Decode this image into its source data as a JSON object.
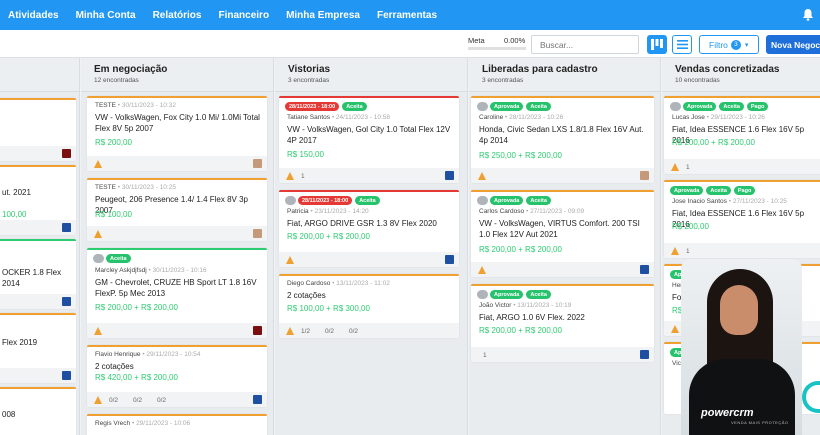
{
  "nav": {
    "items": [
      "Atividades",
      "Minha Conta",
      "Relatórios",
      "Financeiro",
      "Minha Empresa",
      "Ferramentas"
    ]
  },
  "toolbar": {
    "meta_label": "Meta",
    "meta_value": "0.00%",
    "meta_progress": 0,
    "search_placeholder": "Buscar...",
    "filter_label": "Filtro",
    "filter_count": "3",
    "new_button": "Nova Negociação"
  },
  "columns": [
    {
      "title": "",
      "count": "",
      "cards": [
        {
          "meta": "",
          "date": "",
          "vehicle": "",
          "price": ""
        },
        {
          "meta": "",
          "date": "",
          "vehicle": "ut. 2021",
          "price": "100,00"
        },
        {
          "meta": "",
          "date": "",
          "vehicle": "OCKER 1.8 Flex 2014",
          "price": ""
        },
        {
          "meta": "",
          "date": "",
          "vehicle": "Flex 2019",
          "price": ""
        },
        {
          "meta": "",
          "date": "",
          "vehicle": "008",
          "price": ""
        }
      ]
    },
    {
      "title": "Em negociação",
      "count": "12 encontradas",
      "cards": [
        {
          "meta": "TESTE",
          "date": "• 30/11/2023 - 10:32",
          "vehicle": "VW - VolksWagen, Fox City 1.0 Mi/ 1.0Mi Total Flex 8V 5p 2007",
          "price": "R$ 200,00"
        },
        {
          "meta": "TESTE",
          "date": "• 30/11/2023 - 10:25",
          "vehicle": "Peugeot, 206 Presence 1.4/ 1.4 Flex 8V 3p 2007",
          "price": "R$ 100,00"
        },
        {
          "meta": "Marcley Askjdjfsdj",
          "date": "• 30/11/2023 - 10:16",
          "vehicle": "GM - Chevrolet, CRUZE HB Sport LT 1.8 16V FlexP. 5p Mec 2013",
          "price": "R$ 200,00 + R$ 200,00",
          "badges": [
            "Aceita"
          ]
        },
        {
          "meta": "Flavio Henrique",
          "date": "• 29/11/2023 - 10:54",
          "vehicle": "2 cotações",
          "price": "R$ 420,00 + R$ 200,00",
          "stats": [
            "0/2",
            "0/2",
            "0/2"
          ]
        },
        {
          "meta": "Regis Vrech",
          "date": "• 29/11/2023 - 10:06",
          "vehicle": "",
          "price": ""
        }
      ]
    },
    {
      "title": "Vistorias",
      "count": "3 encontradas",
      "cards": [
        {
          "meta": "Tatiane Santos",
          "date": "• 24/11/2023 - 10:58",
          "vehicle": "VW - VolksWagen, Gol City 1.0 Total Flex 12V 4P 2017",
          "price": "R$ 150,00",
          "badges": [
            "28/11/2023 - 18:00",
            "Aceita"
          ],
          "stats": [
            "1"
          ]
        },
        {
          "meta": "Patricia",
          "date": "• 23/11/2023 - 14:20",
          "vehicle": "Fiat, ARGO DRIVE GSR 1.3 8V Flex 2020",
          "price": "R$ 200,00 + R$ 200,00",
          "badges": [
            "28/11/2023 - 18:00",
            "Aceita"
          ]
        },
        {
          "meta": "Diego Cardoso",
          "date": "• 13/11/2023 - 11:02",
          "vehicle": "2 cotações",
          "price": "R$ 100,00 + R$ 300,00",
          "stats": [
            "1/2",
            "0/2",
            "0/2"
          ]
        }
      ]
    },
    {
      "title": "Liberadas para cadastro",
      "count": "3 encontradas",
      "cards": [
        {
          "meta": "Caroline",
          "date": "• 28/11/2023 - 10:26",
          "vehicle": "Honda, Civic Sedan LXS 1.8/1.8 Flex 16V Aut. 4p 2014",
          "price": "R$ 250,00 + R$ 200,00",
          "badges": [
            "Aprovada",
            "Aceita"
          ]
        },
        {
          "meta": "Carlos Cardoso",
          "date": "• 27/11/2023 - 09:09",
          "vehicle": "VW - VolksWagen, VIRTUS Comfort. 200 TSI 1.0 Flex 12V Aut 2021",
          "price": "R$ 200,00 + R$ 200,00",
          "badges": [
            "Aprovada",
            "Aceita"
          ]
        },
        {
          "meta": "João Victor",
          "date": "• 13/11/2023 - 10:19",
          "vehicle": "Fiat, ARGO 1.0 6V Flex. 2022",
          "price": "R$ 200,00 + R$ 200,00",
          "badges": [
            "Aprovada",
            "Aceita"
          ],
          "stats": [
            "1"
          ]
        }
      ]
    },
    {
      "title": "Vendas concretizadas",
      "count": "10 encontradas",
      "cards": [
        {
          "meta": "Lucas Jose",
          "date": "• 29/11/2023 - 10:26",
          "vehicle": "Fiat, Idea ESSENCE 1.6 Flex 16V 5p 2016",
          "price": "R$ 200,00 + R$ 200,00",
          "badges": [
            "Aprovada",
            "Aceita",
            "Pago"
          ],
          "stats": [
            "1"
          ]
        },
        {
          "meta": "Jose Inacio Santos",
          "date": "• 27/11/2023 - 10:25",
          "vehicle": "Fiat, Idea ESSENCE 1.6 Flex 16V 5p 2016",
          "price": "R$ 200,00",
          "badges": [
            "Aprovada",
            "Aceita",
            "Pago"
          ],
          "stats": [
            "1"
          ]
        },
        {
          "meta": "Henr",
          "date": "",
          "vehicle": "Ford",
          "price": "R$ 2",
          "badges": [
            "Aprovada"
          ]
        },
        {
          "meta": "Vicia",
          "date": "",
          "vehicle": "",
          "price": "",
          "badges": [
            "Aprovada"
          ]
        }
      ]
    }
  ],
  "presenter": {
    "logo": "powercrm",
    "logo_sub": "VENDA MAIS PROTEÇÃO"
  },
  "colors": {
    "primary": "#2196f3",
    "success": "#27c26c",
    "warning": "#f0a030",
    "danger": "#e53935"
  }
}
